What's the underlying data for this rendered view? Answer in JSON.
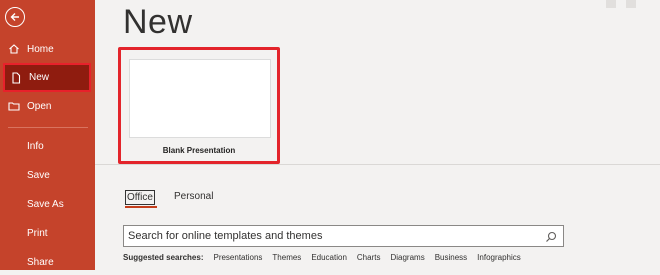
{
  "sidebar": {
    "items": [
      {
        "label": "Home"
      },
      {
        "label": "New"
      },
      {
        "label": "Open"
      },
      {
        "label": "Info"
      },
      {
        "label": "Save"
      },
      {
        "label": "Save As"
      },
      {
        "label": "Print"
      },
      {
        "label": "Share"
      }
    ]
  },
  "main": {
    "title": "New",
    "template": {
      "label": "Blank Presentation"
    },
    "tabs": [
      {
        "label": "Office"
      },
      {
        "label": "Personal"
      }
    ],
    "search": {
      "placeholder": "Search for online templates and themes"
    },
    "suggested": {
      "label": "Suggested searches:",
      "items": [
        "Presentations",
        "Themes",
        "Education",
        "Charts",
        "Diagrams",
        "Business",
        "Infographics"
      ]
    }
  },
  "colors": {
    "sidebar": "#c5432b",
    "active_item": "#8f1c0f",
    "highlight": "#e3242b",
    "tab_underline": "#c43e1c"
  }
}
